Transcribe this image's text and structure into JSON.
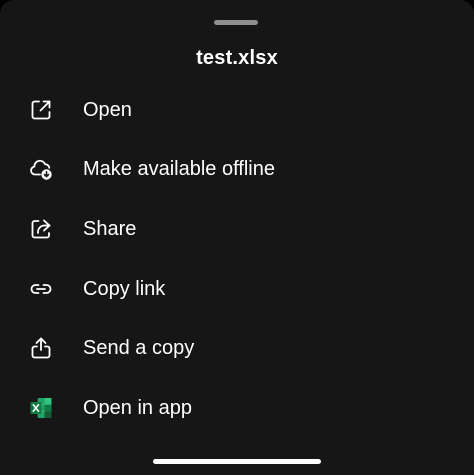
{
  "sheet": {
    "title": "test.xlsx"
  },
  "menu": {
    "items": [
      {
        "label": "Open",
        "icon": "open-external-icon"
      },
      {
        "label": "Make available offline",
        "icon": "cloud-download-icon"
      },
      {
        "label": "Share",
        "icon": "share-icon"
      },
      {
        "label": "Copy link",
        "icon": "link-icon"
      },
      {
        "label": "Send a copy",
        "icon": "send-copy-icon"
      },
      {
        "label": "Open in app",
        "icon": "excel-icon"
      }
    ]
  },
  "colors": {
    "background": "#161616",
    "text": "#ffffff",
    "excel_green": "#1d7a45"
  }
}
